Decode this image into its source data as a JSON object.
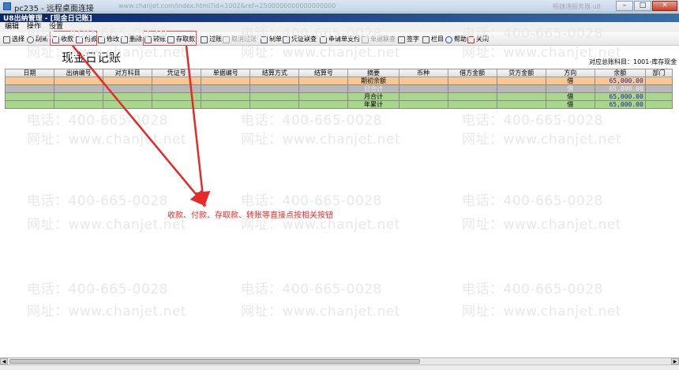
{
  "window": {
    "title": "pc235 - 远程桌面连接",
    "url_hint": "www.chanjet.com/index.html?id=1002&ref=2500000000000000000",
    "right_hint": "畅捷通服务器 u8"
  },
  "app": {
    "title": "U8出纳管理 - [现金日记账]",
    "menu": [
      "编辑",
      "操作",
      "设置"
    ]
  },
  "toolbar": {
    "select": "选择",
    "refresh": "刷新",
    "receive": "收款",
    "pay": "付款",
    "modify": "修改",
    "delete": "删除",
    "transfer": "转账",
    "deposit": "存取款",
    "post": "过账",
    "unpost": "取消过账",
    "make_voucher": "制单",
    "voucher_link": "凭证联查",
    "request_pay": "申请单支付",
    "doc_link": "单据联查",
    "sign": "签字",
    "columns": "栏目",
    "help": "帮助",
    "close": "关闭"
  },
  "page": {
    "heading": "现金日记账",
    "subject": "对应总账科目：1001-库存现金"
  },
  "table": {
    "headers": [
      "日期",
      "出纳编号",
      "对方科目",
      "凭证号",
      "单据编号",
      "结算方式",
      "结算号",
      "摘要",
      "币种",
      "借方金额",
      "贷方金额",
      "方向",
      "余额",
      "部门"
    ],
    "rows": [
      {
        "summary": "期初余额",
        "direction": "借",
        "balance": "65,000.00",
        "style": "orange"
      },
      {
        "summary": "日合计",
        "direction": "借",
        "balance": "65,000.00",
        "style": "gray"
      },
      {
        "summary": "月合计",
        "direction": "借",
        "balance": "65,000.00",
        "style": "green"
      },
      {
        "summary": "年累计",
        "direction": "借",
        "balance": "65,000.00",
        "style": "green"
      }
    ]
  },
  "watermark": {
    "phone": "电话：400-665-0028",
    "site": "网址：www.chanjet.net"
  },
  "annotation": {
    "text": "收款、付款、存取款、转账等直接点按相关按钮",
    "color": "#e52a2a"
  },
  "colors": {
    "orange_row": "#f8c894",
    "gray_row": "#b8b8b8",
    "green_row": "#a8d68a",
    "title_blue": "#0a246a"
  }
}
